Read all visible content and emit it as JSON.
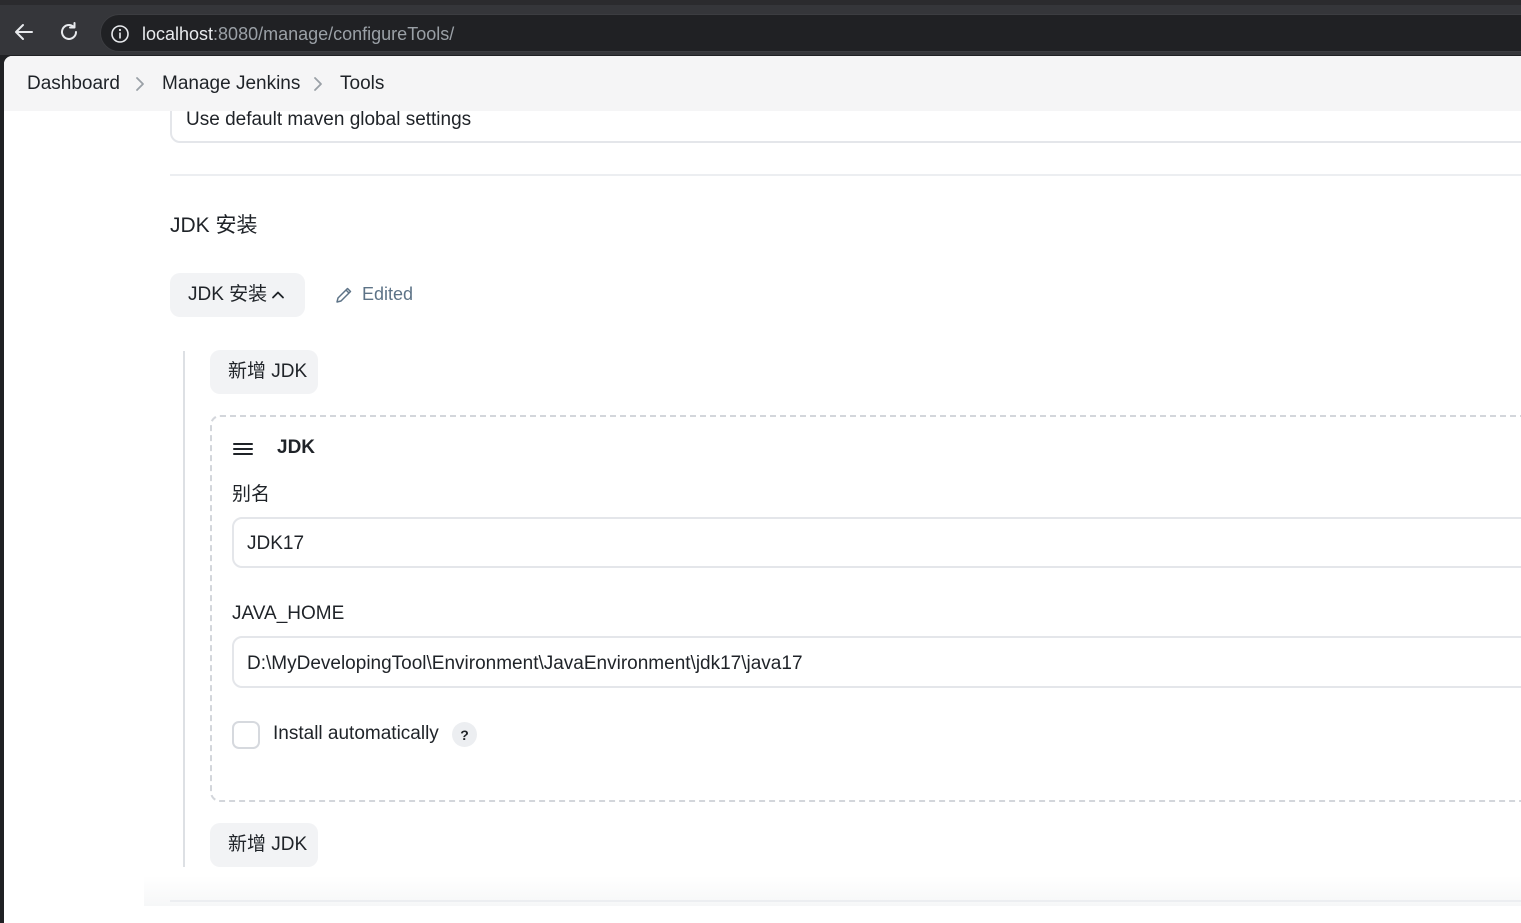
{
  "browser": {
    "url_host": "localhost",
    "url_rest": ":8080/manage/configureTools/",
    "icons": {
      "back": "arrow-left-icon",
      "reload": "reload-icon",
      "site_info": "info-circle-icon"
    }
  },
  "breadcrumb": {
    "items": [
      "Dashboard",
      "Manage Jenkins",
      "Tools"
    ]
  },
  "maven": {
    "global_settings_value": "Use default maven global settings"
  },
  "jdk_section": {
    "title": "JDK 安装",
    "toggle_label": "JDK 安装",
    "edited_label": "Edited",
    "add_button_label": "新增 JDK",
    "installation": {
      "heading": "JDK",
      "alias_label": "别名",
      "alias_value": "JDK17",
      "java_home_label": "JAVA_HOME",
      "java_home_value": "D:\\MyDevelopingTool\\Environment\\JavaEnvironment\\jdk17\\java17",
      "install_auto_label": "Install automatically",
      "install_auto_checked": false,
      "help_label": "?"
    }
  },
  "colors": {
    "browser_toolbar": "#35363a",
    "breadcrumb_bg": "#f5f5f6",
    "pill_bg": "#f2f3f5",
    "edited_text": "#5d7387"
  }
}
